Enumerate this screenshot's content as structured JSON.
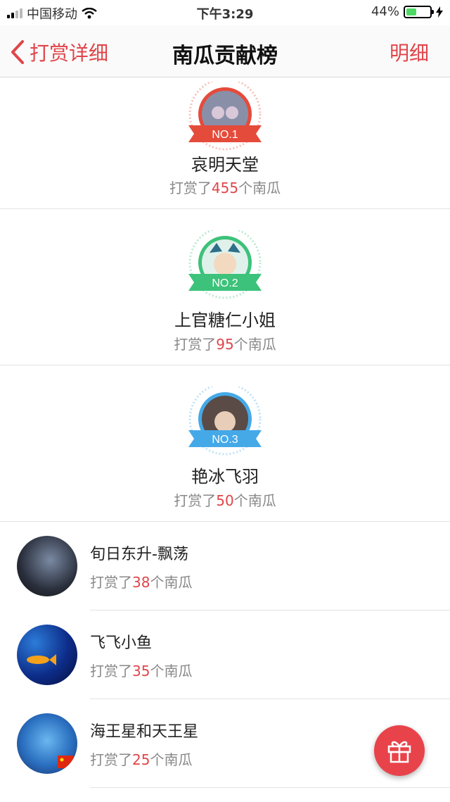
{
  "status_bar": {
    "carrier": "中国移动",
    "time": "下午3:29",
    "battery": "44%",
    "battery_level": 0.44
  },
  "nav": {
    "back_label": "打赏详细",
    "title": "南瓜贡献榜",
    "right_label": "明细"
  },
  "top": [
    {
      "rank": "NO.1",
      "name": "哀明天堂",
      "count_prefix": "打赏了",
      "count": "455",
      "count_suffix": "个南瓜",
      "color": "#e54b3b"
    },
    {
      "rank": "NO.2",
      "name": "上官糖仁小姐",
      "count_prefix": "打赏了",
      "count": "95",
      "count_suffix": "个南瓜",
      "color": "#3cc27a"
    },
    {
      "rank": "NO.3",
      "name": "艳冰飞羽",
      "count_prefix": "打赏了",
      "count": "50",
      "count_suffix": "个南瓜",
      "color": "#45a9e8"
    }
  ],
  "list": [
    {
      "name": "旬日东升-飘荡",
      "count_prefix": "打赏了",
      "count": "38",
      "count_suffix": "个南瓜"
    },
    {
      "name": "飞飞小鱼",
      "count_prefix": "打赏了",
      "count": "35",
      "count_suffix": "个南瓜"
    },
    {
      "name": "海王星和天王星",
      "count_prefix": "打赏了",
      "count": "25",
      "count_suffix": "个南瓜"
    }
  ],
  "colors": {
    "accent": "#e0454a",
    "gift": "#e8434a"
  },
  "icons": {
    "back": "chevron-left-icon",
    "gift": "gift-icon",
    "wifi": "wifi-icon",
    "charging": "bolt-icon"
  }
}
